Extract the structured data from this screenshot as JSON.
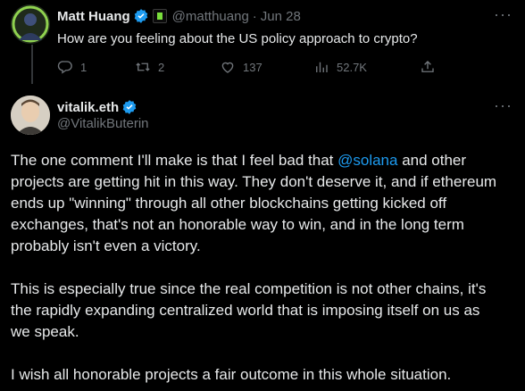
{
  "tweet1": {
    "name": "Matt Huang",
    "handle": "@matthuang",
    "separator": "·",
    "date": "Jun 28",
    "text": "How are you feeling about the US policy approach to crypto?",
    "replies": "1",
    "retweets": "2",
    "likes": "137",
    "views": "52.7K"
  },
  "tweet2": {
    "name": "vitalik.eth",
    "handle": "@VitalikButerin",
    "p1": {
      "before": "The one comment I'll make is that I feel bad that ",
      "mention": "@solana",
      "l1_after": " and other",
      "l2": "projects are getting hit in this way. They don't deserve it, and if ethereum",
      "l3": "ends up \"winning\" through all other blockchains getting kicked off",
      "l4": "exchanges, that's not an honorable way to win, and in the long term",
      "l5": "probably isn't even a victory."
    },
    "p2": {
      "l1": "This is especially true since the real competition is not other chains, it's",
      "l2": "the rapidly expanding centralized world that is imposing itself on us as",
      "l3": "we speak."
    },
    "p3": {
      "l1": "I wish all honorable projects a fair outcome in this whole situation."
    }
  },
  "more_icon": "···",
  "colors": {
    "background": "#000000",
    "text": "#e7e9ea",
    "muted": "#71767b",
    "link": "#1d9bf0",
    "verified": "#1d9bf0"
  }
}
